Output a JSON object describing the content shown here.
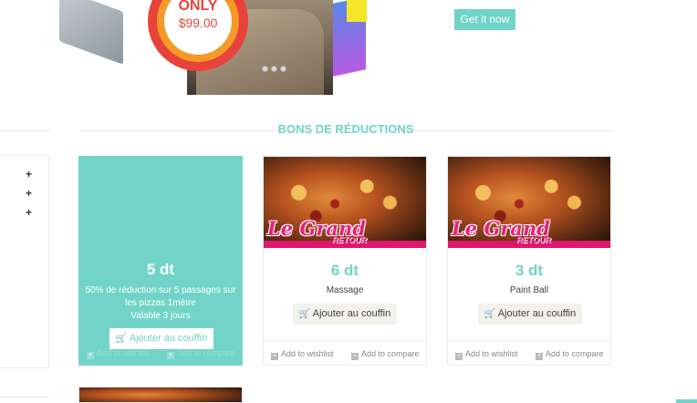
{
  "hero": {
    "promo_only": "ONLY",
    "promo_price": "$99.00",
    "cta_label": "Get it now"
  },
  "section": {
    "title": "BONS DE RÉDUCTIONS"
  },
  "cards": [
    {
      "price": "5 dt",
      "description": "50% de réduction sur 5 passages sur les pizzas 1mètre",
      "validity": "Valable 3 jours",
      "add_label": "Ajouter au couffin",
      "wishlist_label": "Add to wishlist",
      "compare_label": "Add to compare"
    },
    {
      "price": "6 dt",
      "description": "Massage",
      "image_title": "Le Grand",
      "image_subtitle": "RETOUR",
      "add_label": "Ajouter au couffin",
      "wishlist_label": "Add to wishlist",
      "compare_label": "Add to compare"
    },
    {
      "price": "3 dt",
      "description": "Paint Ball",
      "image_title": "Le Grand",
      "image_subtitle": "RETOUR",
      "add_label": "Ajouter au couffin",
      "wishlist_label": "Add to wishlist",
      "compare_label": "Add to compare"
    }
  ],
  "colors": {
    "accent": "#6fd3c7",
    "promo": "#e8433a",
    "pizza_text": "#e91e7a"
  },
  "icons": {
    "cart": "shopping-cart-icon",
    "plus": "plus-icon"
  }
}
